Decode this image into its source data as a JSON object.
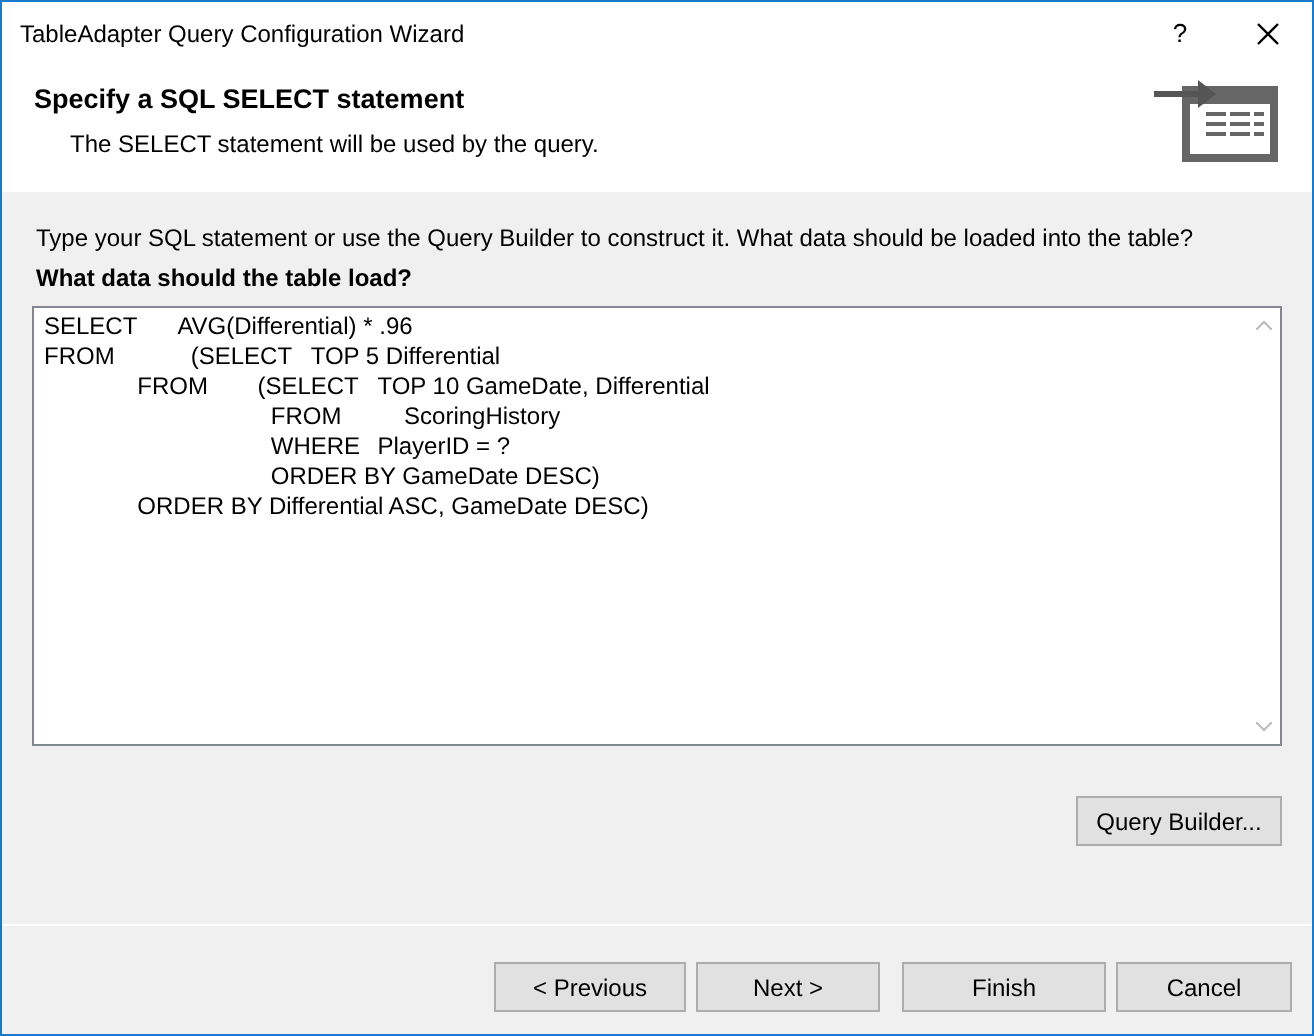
{
  "window": {
    "title": "TableAdapter Query Configuration Wizard",
    "help": "?"
  },
  "header": {
    "title": "Specify a SQL SELECT statement",
    "subtitle": "The SELECT statement will be used by the query."
  },
  "instructions": "Type your SQL statement or use the Query Builder to construct it. What data should be loaded into the table?",
  "editor": {
    "label": "What data should the table load?",
    "lines": [
      "SELECT\tAVG(Differential) * .96",
      "FROM\t  (SELECT\tTOP 5 Differential",
      "\t    FROM\t  (SELECT\tTOP 10 GameDate, Differential",
      "\t\t\t    FROM\t    ScoringHistory",
      "\t\t\t    WHERE\tPlayerID = ?",
      "\t\t\t    ORDER BY GameDate DESC)",
      "\t    ORDER BY Differential ASC, GameDate DESC)"
    ]
  },
  "query_builder": "Query Builder...",
  "buttons": [
    {
      "label": "< Previous",
      "disabled": false
    },
    {
      "label": "Next >",
      "disabled": false
    },
    {
      "label": "Finish",
      "disabled": false
    },
    {
      "label": "Cancel",
      "disabled": false
    }
  ]
}
